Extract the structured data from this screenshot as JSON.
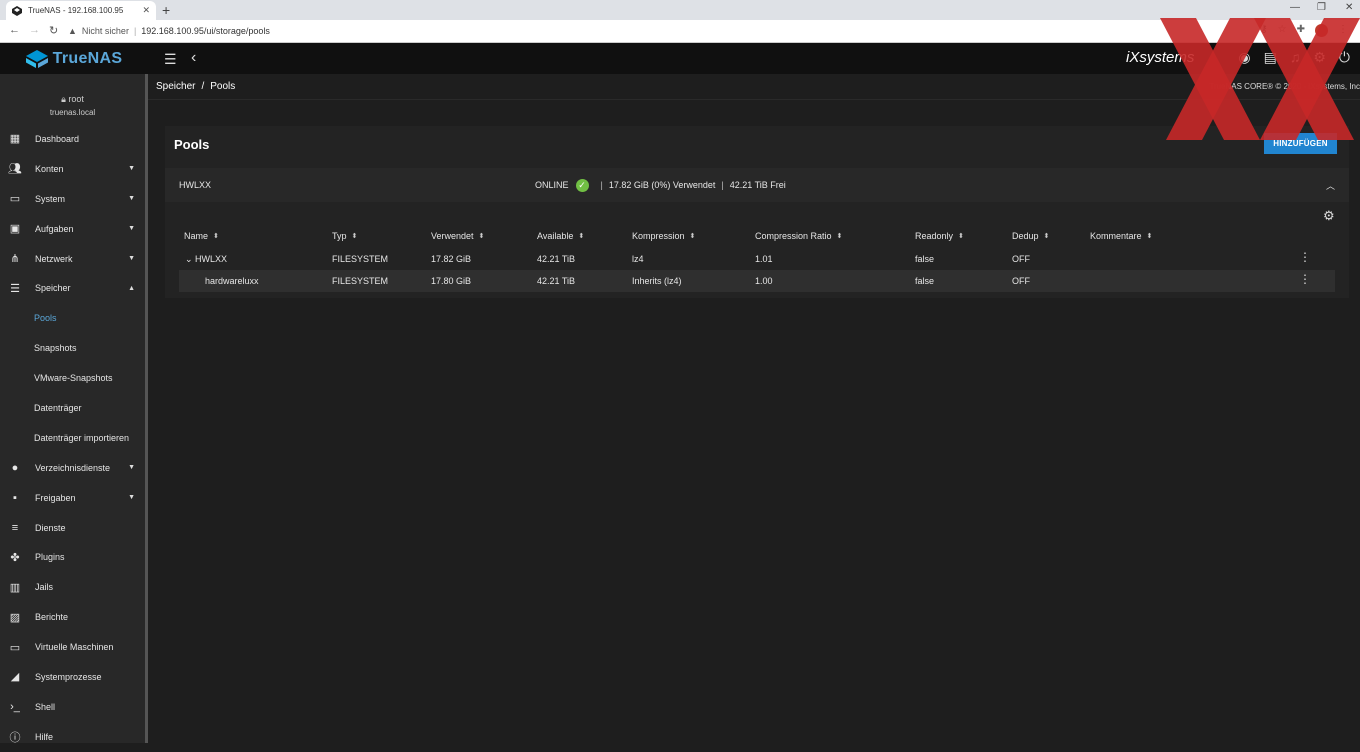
{
  "browser": {
    "tab_title": "TrueNAS - 192.168.100.95",
    "tab_close": "✕",
    "new_tab": "+",
    "security_label": "Nicht sicher",
    "url": "192.168.100.95/ui/storage/pools",
    "window_controls": [
      "—",
      "❐",
      "✕"
    ]
  },
  "topbar": {
    "logo_text": "TrueNAS",
    "vendor_logo": "iXsystems"
  },
  "sidebar": {
    "user": "root",
    "host": "truenas.local",
    "items": [
      {
        "label": "Dashboard",
        "icon": "dashboard-icon"
      },
      {
        "label": "Konten",
        "icon": "accounts-icon",
        "expandable": true
      },
      {
        "label": "System",
        "icon": "laptop-icon",
        "expandable": true
      },
      {
        "label": "Aufgaben",
        "icon": "calendar-icon",
        "expandable": true
      },
      {
        "label": "Netzwerk",
        "icon": "network-icon",
        "expandable": true
      },
      {
        "label": "Speicher",
        "icon": "storage-icon",
        "expandable": true,
        "expanded": true
      }
    ],
    "sub_items": [
      {
        "label": "Pools",
        "active": true
      },
      {
        "label": "Snapshots"
      },
      {
        "label": "VMware-Snapshots"
      },
      {
        "label": "Datenträger"
      },
      {
        "label": "Datenträger importieren"
      }
    ],
    "items_after": [
      {
        "label": "Verzeichnisdienste",
        "icon": "directory-icon",
        "expandable": true
      },
      {
        "label": "Freigaben",
        "icon": "shares-icon",
        "expandable": true
      },
      {
        "label": "Dienste",
        "icon": "services-icon"
      },
      {
        "label": "Plugins",
        "icon": "puzzle-icon"
      },
      {
        "label": "Jails",
        "icon": "jails-icon"
      },
      {
        "label": "Berichte",
        "icon": "reports-icon"
      },
      {
        "label": "Virtuelle Maschinen",
        "icon": "vm-icon"
      },
      {
        "label": "Systemprozesse",
        "icon": "processes-icon"
      },
      {
        "label": "Shell",
        "icon": "shell-icon"
      },
      {
        "label": "Hilfe",
        "icon": "help-icon"
      }
    ]
  },
  "breadcrumb": {
    "parent": "Speicher",
    "separator": "/",
    "current": "Pools"
  },
  "copyright": "TrueNAS CORE® © 2020 - iXsystems, Inc",
  "main": {
    "title": "Pools",
    "add_button": "HINZUFÜGEN",
    "pool": {
      "name": "HWLXX",
      "status": "ONLINE",
      "used": "17.82 GiB (0%) Verwendet",
      "free": "42.21 TiB Frei",
      "separator": "|"
    },
    "columns": [
      "Name",
      "Typ",
      "Verwendet",
      "Available",
      "Kompression",
      "Compression Ratio",
      "Readonly",
      "Dedup",
      "Kommentare"
    ],
    "rows": [
      {
        "name": "HWLXX",
        "type": "FILESYSTEM",
        "used": "17.82 GiB",
        "available": "42.21 TiB",
        "compression": "lz4",
        "ratio": "1.01",
        "readonly": "false",
        "dedup": "OFF",
        "comments": ""
      },
      {
        "name": "hardwareluxx",
        "type": "FILESYSTEM",
        "used": "17.80 GiB",
        "available": "42.21 TiB",
        "compression": "Inherits (lz4)",
        "ratio": "1.00",
        "readonly": "false",
        "dedup": "OFF",
        "comments": ""
      }
    ]
  }
}
